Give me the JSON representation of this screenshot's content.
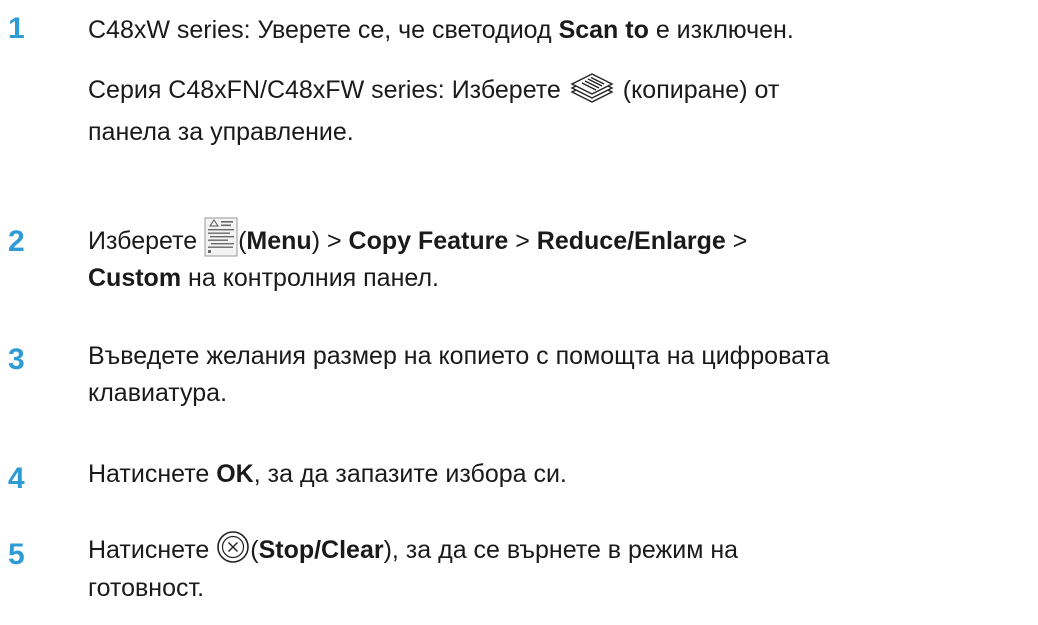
{
  "colors": {
    "step_number": "#2f9bd6",
    "text": "#1a1a1a"
  },
  "steps": [
    {
      "number": "1",
      "line1": {
        "a": "C48xW series: Уверете се, че светодиод ",
        "b": "Scan to",
        "c": " е изключен."
      },
      "line2": {
        "a": "Серия C48xFN/C48xFW series: Изберете ",
        "icon": "copy-icon",
        "b": " (копиране) от"
      },
      "line3": {
        "a": "панела за управление."
      }
    },
    {
      "number": "2",
      "line1": {
        "a": "Изберете ",
        "icon": "menu-icon",
        "paren_open": "(",
        "b": "Menu",
        "c": ") > ",
        "d": "Copy Feature",
        "e": " > ",
        "f": "Reduce/Enlarge",
        "g": " >"
      },
      "line2": {
        "a": "Custom",
        "b": " на контролния панел."
      }
    },
    {
      "number": "3",
      "line1": {
        "a": "Въведете желания размер на копието с помощта на цифровата"
      },
      "line2": {
        "a": "клавиатура."
      }
    },
    {
      "number": "4",
      "line1": {
        "a": "Натиснете ",
        "b": "OK",
        "c": ", за да запазите избора си."
      }
    },
    {
      "number": "5",
      "line1": {
        "a": "Натиснете ",
        "icon": "stop-clear-icon",
        "paren_open": "(",
        "b": "Stop/Clear",
        "c": "), за да се върнете в режим на"
      },
      "line2": {
        "a": "готовност."
      }
    }
  ]
}
